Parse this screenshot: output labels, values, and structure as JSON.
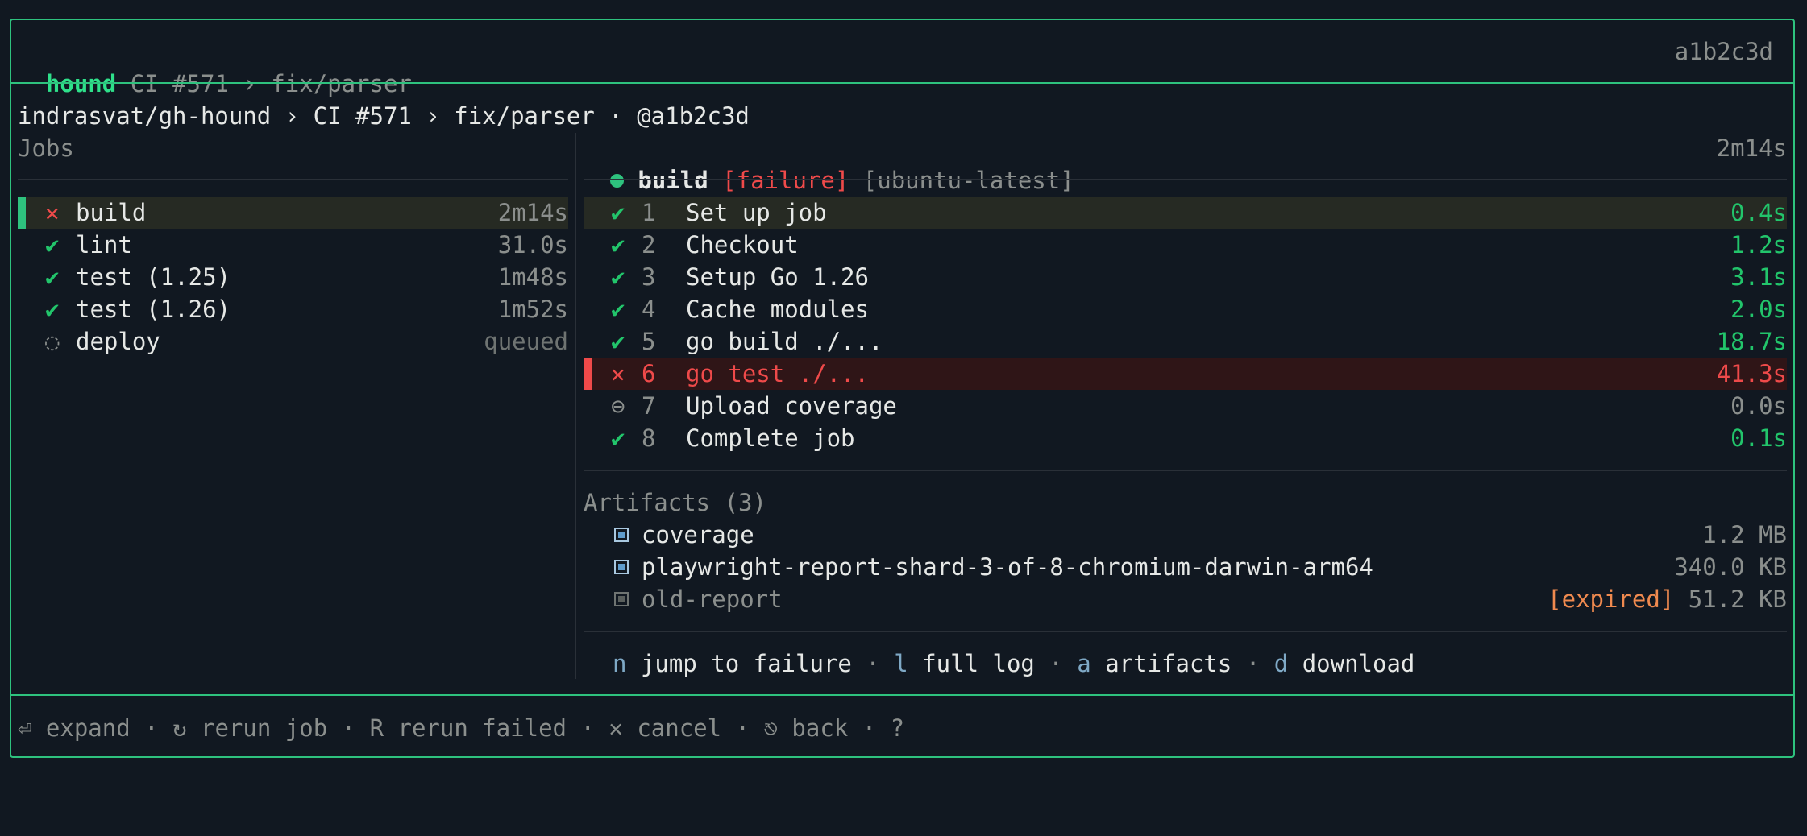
{
  "titlebar": {
    "app": "hound",
    "run": "CI #571",
    "sep": "›",
    "branch": "fix/parser",
    "sha": "a1b2c3d"
  },
  "breadcrumb": "indrasvat/gh-hound › CI #571 › fix/parser · @a1b2c3d",
  "jobs": {
    "header": "Jobs",
    "items": [
      {
        "icon": "✕",
        "icon_name": "x-icon",
        "name": "build",
        "duration": "2m14s",
        "status": "failure"
      },
      {
        "icon": "✔",
        "icon_name": "check-icon",
        "name": "lint",
        "duration": "31.0s",
        "status": "success"
      },
      {
        "icon": "✔",
        "icon_name": "check-icon",
        "name": "test (1.25)",
        "duration": "1m48s",
        "status": "success"
      },
      {
        "icon": "✔",
        "icon_name": "check-icon",
        "name": "test (1.26)",
        "duration": "1m52s",
        "status": "success"
      },
      {
        "icon": "◌",
        "icon_name": "queued-icon",
        "name": "deploy",
        "duration": "queued",
        "status": "queued"
      }
    ]
  },
  "detail": {
    "job_name": "build",
    "status_tag": "[failure]",
    "runner_tag": "[ubuntu-latest]",
    "duration": "2m14s",
    "steps": [
      {
        "icon": "✔",
        "icon_name": "check-icon",
        "num": "1",
        "name": "Set up job",
        "duration": "0.4s",
        "status": "success"
      },
      {
        "icon": "✔",
        "icon_name": "check-icon",
        "num": "2",
        "name": "Checkout",
        "duration": "1.2s",
        "status": "success"
      },
      {
        "icon": "✔",
        "icon_name": "check-icon",
        "num": "3",
        "name": "Setup Go 1.26",
        "duration": "3.1s",
        "status": "success"
      },
      {
        "icon": "✔",
        "icon_name": "check-icon",
        "num": "4",
        "name": "Cache modules",
        "duration": "2.0s",
        "status": "success"
      },
      {
        "icon": "✔",
        "icon_name": "check-icon",
        "num": "5",
        "name": "go build ./...",
        "duration": "18.7s",
        "status": "success"
      },
      {
        "icon": "✕",
        "icon_name": "x-icon",
        "num": "6",
        "name": "go test ./...",
        "duration": "41.3s",
        "status": "failure"
      },
      {
        "icon": "⊖",
        "icon_name": "skipped-icon",
        "num": "7",
        "name": "Upload coverage",
        "duration": "0.0s",
        "status": "skipped"
      },
      {
        "icon": "✔",
        "icon_name": "check-icon",
        "num": "8",
        "name": "Complete job",
        "duration": "0.1s",
        "status": "success"
      }
    ],
    "artifacts_header": "Artifacts (3)",
    "artifacts": [
      {
        "name": "coverage",
        "size": "1.2 MB",
        "expired": ""
      },
      {
        "name": "playwright-report-shard-3-of-8-chromium-darwin-arm64",
        "size": "340.0 KB",
        "expired": ""
      },
      {
        "name": "old-report",
        "size": "51.2 KB",
        "expired": "[expired]"
      }
    ],
    "hints": [
      {
        "key": "n",
        "label": "jump to failure"
      },
      {
        "key": "l",
        "label": "full log"
      },
      {
        "key": "a",
        "label": "artifacts"
      },
      {
        "key": "d",
        "label": "download"
      }
    ],
    "hint_sep": "·"
  },
  "footer": {
    "items": [
      "⏎ expand",
      "↻ rerun job",
      "R rerun failed",
      "✕ cancel",
      "⎋ back",
      "?"
    ],
    "sep": "·"
  },
  "colors": {
    "accent": "#2ec27e",
    "background": "#111821",
    "failure": "#ef4a4a",
    "success": "#22c56b",
    "expired": "#f08a4f"
  }
}
